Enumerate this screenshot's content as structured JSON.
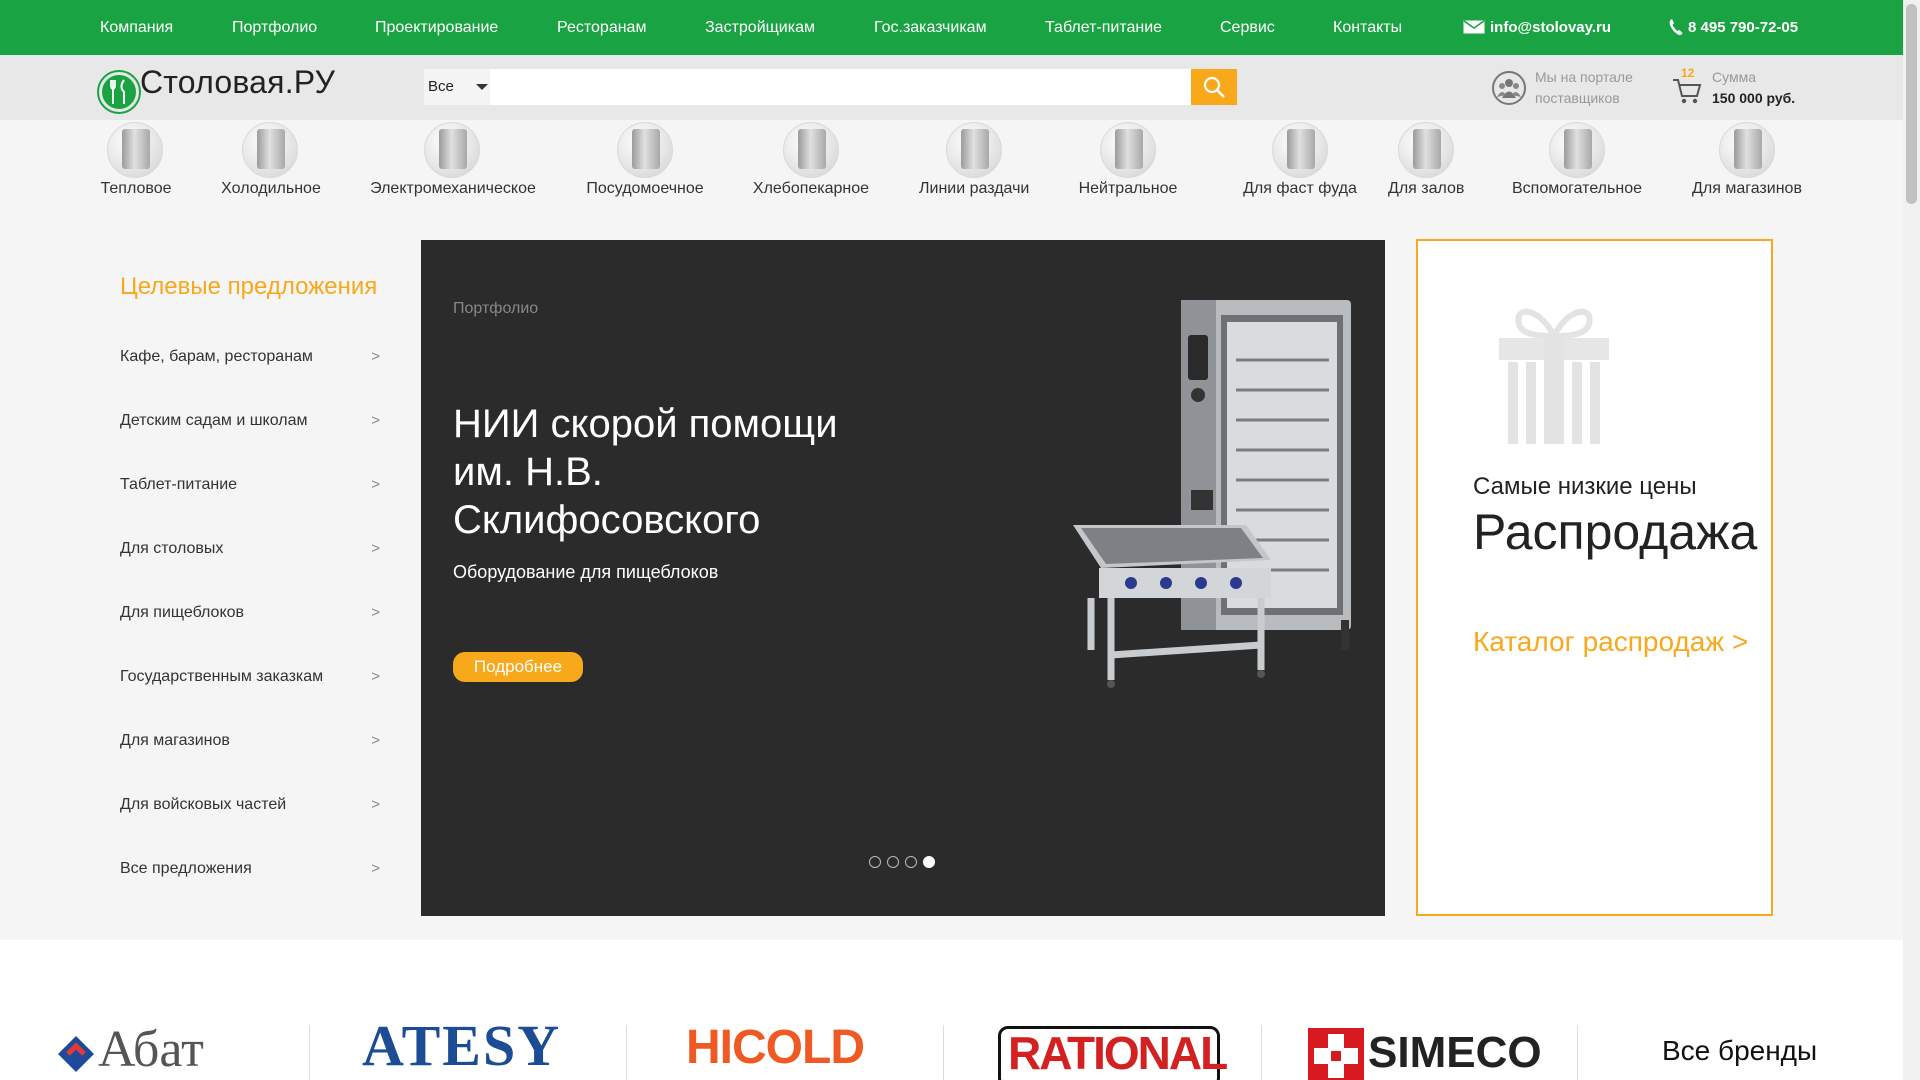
{
  "topnav": {
    "items": [
      "Компания",
      "Портфолио",
      "Проектирование",
      "Ресторанам",
      "Застройщикам",
      "Гос.заказчикам",
      "Таблет-питание",
      "Сервис",
      "Контакты"
    ],
    "email": "info@stolovay.ru",
    "phone": "8 495 790-72-05"
  },
  "header": {
    "logo_text": "Столовая.РУ",
    "search": {
      "category": "Все",
      "placeholder": "",
      "value": ""
    },
    "suppliers_line1": "Мы на портале",
    "suppliers_line2": "поставщиков",
    "cart_count": "12",
    "cart_label": "Сумма",
    "cart_sum": "150 000 руб."
  },
  "categories": [
    "Тепловое",
    "Холодильное",
    "Электромеханическое",
    "Посудомоечное",
    "Хлебопекарное",
    "Линии раздачи",
    "Нейтральное",
    "Для фаст фуда",
    "Для залов",
    "Вспомогательное",
    "Для магазинов"
  ],
  "offers": {
    "title": "Целевые предложения",
    "items": [
      "Кафе, барам, ресторанам",
      "Детским садам и школам",
      "Таблет-питание",
      "Для столовых",
      "Для пищеблоков",
      "Государственным заказкам",
      "Для магазинов",
      "Для войсковых частей",
      "Все предложения"
    ],
    "arrow": ">"
  },
  "slider": {
    "category": "Портфолио",
    "title": "НИИ скорой помощи им. Н.В. Склифосовского",
    "subtitle": "Оборудование для пищеблоков",
    "button": "Подробнее",
    "dots_count": 4,
    "active_dot": 4
  },
  "sale": {
    "small": "Самые низкие цены",
    "big": "Распродажа",
    "link": "Каталог распродаж >"
  },
  "brands": {
    "items": [
      "Абат",
      "ATESY",
      "HICOLD",
      "RATIONAL",
      "SIMECO"
    ],
    "all_label": "Все бренды"
  },
  "colors": {
    "green": "#1aa342",
    "orange": "#f7a81b",
    "dark": "#2b2b2b"
  }
}
